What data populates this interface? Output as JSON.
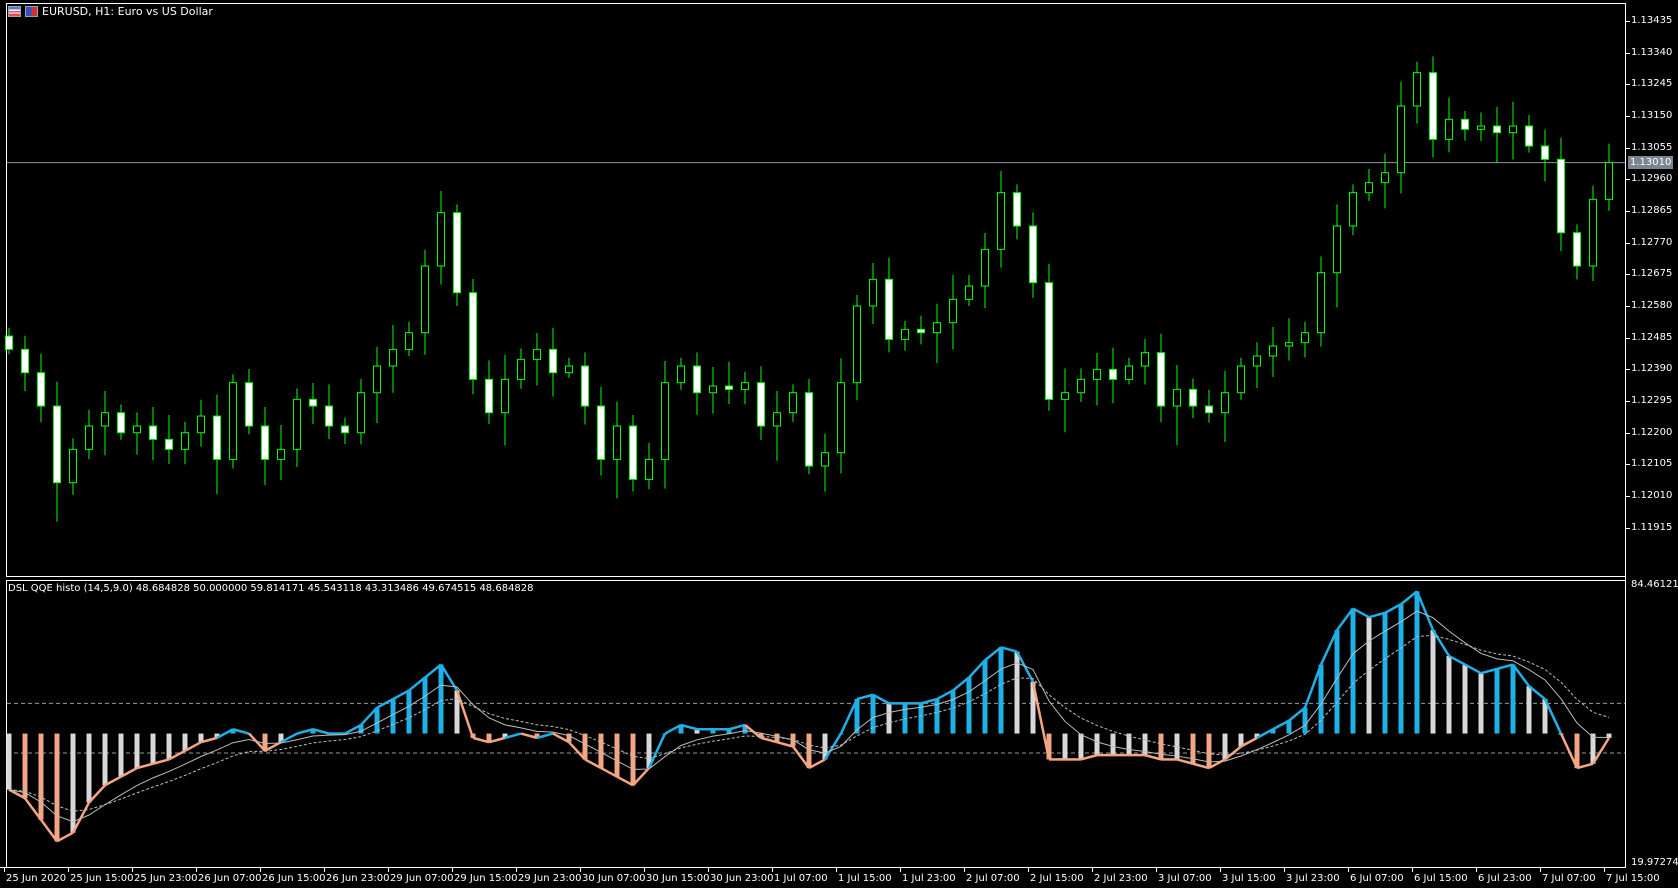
{
  "window": {
    "title": "EURUSD, H1:  Euro vs US Dollar"
  },
  "indicator": {
    "label": "DSL QQE histo (14,5,9.0) 48.684828 50.000000 59.814171 45.543118 43.313486 49.674515 48.684828",
    "max_label": "84.461210",
    "min_label": "19.972748",
    "max": 84.46121,
    "min": 19.972748,
    "mid": 50,
    "upper_level": 57,
    "lower_level": 45.5
  },
  "price_axis": {
    "labels": [
      "1.13435",
      "1.13340",
      "1.13245",
      "1.13150",
      "1.13055",
      "1.12960",
      "1.12865",
      "1.12770",
      "1.12675",
      "1.12580",
      "1.12485",
      "1.12390",
      "1.12295",
      "1.12200",
      "1.12105",
      "1.12010",
      "1.11915"
    ],
    "current_price": "1.13010"
  },
  "time_axis": {
    "labels": [
      "25 Jun 2020",
      "25 Jun 15:00",
      "25 Jun 23:00",
      "26 Jun 07:00",
      "26 Jun 15:00",
      "26 Jun 23:00",
      "29 Jun 07:00",
      "29 Jun 15:00",
      "29 Jun 23:00",
      "30 Jun 07:00",
      "30 Jun 15:00",
      "30 Jun 23:00",
      "1 Jul 07:00",
      "1 Jul 15:00",
      "1 Jul 23:00",
      "2 Jul 07:00",
      "2 Jul 15:00",
      "2 Jul 23:00",
      "3 Jul 07:00",
      "3 Jul 15:00",
      "3 Jul 23:00",
      "6 Jul 07:00",
      "6 Jul 15:00",
      "6 Jul 23:00",
      "7 Jul 07:00",
      "7 Jul 15:00"
    ]
  },
  "colors": {
    "bull": "#00ff00",
    "bear_fill": "#ffffff",
    "up": "#1fb0e6",
    "down": "#f4a582",
    "neutral": "#d8d8d8",
    "grid": "#999999"
  },
  "chart_data": {
    "type": "candlestick",
    "symbol": "EURUSD",
    "timeframe": "H1",
    "ylim": [
      1.1187,
      1.1346
    ],
    "closes": [
      1.1245,
      1.1238,
      1.1228,
      1.1205,
      1.1215,
      1.1222,
      1.1226,
      1.122,
      1.1222,
      1.1218,
      1.1215,
      1.122,
      1.1225,
      1.1212,
      1.1235,
      1.1222,
      1.1212,
      1.1215,
      1.123,
      1.1228,
      1.1222,
      1.122,
      1.1232,
      1.124,
      1.1245,
      1.125,
      1.127,
      1.1286,
      1.1262,
      1.1236,
      1.1226,
      1.1236,
      1.1242,
      1.1245,
      1.1238,
      1.124,
      1.1228,
      1.1212,
      1.1222,
      1.1206,
      1.1212,
      1.1235,
      1.124,
      1.1232,
      1.1234,
      1.1233,
      1.1235,
      1.1222,
      1.1226,
      1.1232,
      1.121,
      1.1214,
      1.1235,
      1.1258,
      1.1266,
      1.1248,
      1.1251,
      1.125,
      1.1253,
      1.126,
      1.1264,
      1.1275,
      1.1292,
      1.1282,
      1.1265,
      1.123,
      1.1232,
      1.1236,
      1.1239,
      1.1236,
      1.124,
      1.1244,
      1.1228,
      1.1233,
      1.1228,
      1.1226,
      1.1232,
      1.124,
      1.1243,
      1.1246,
      1.1247,
      1.125,
      1.1268,
      1.1282,
      1.1292,
      1.1295,
      1.1298,
      1.1318,
      1.1328,
      1.1308,
      1.1314,
      1.1311,
      1.1312,
      1.131,
      1.1312,
      1.1306,
      1.1302,
      1.128,
      1.127,
      1.129,
      1.1301
    ],
    "qqe": [
      37,
      35,
      30,
      25,
      27,
      34,
      38,
      40,
      42,
      43,
      44,
      46,
      48,
      49,
      51,
      50,
      46,
      48,
      50,
      51,
      50,
      50,
      52,
      56,
      58,
      60,
      63,
      66,
      60,
      49,
      48,
      49,
      50,
      49,
      50,
      48,
      44,
      42,
      40,
      38,
      42,
      50,
      52,
      51,
      51,
      51,
      52,
      49,
      48,
      47,
      42,
      44,
      50,
      58,
      59,
      57,
      57,
      57,
      58,
      60,
      63,
      67,
      70,
      69,
      62,
      44,
      44,
      44,
      45,
      45,
      45,
      45,
      44,
      44,
      43,
      42,
      44,
      47,
      49,
      51,
      53,
      56,
      66,
      74,
      79,
      77,
      78,
      80,
      83,
      74,
      68,
      66,
      64,
      65,
      66,
      61,
      58,
      50,
      42,
      43,
      49
    ]
  }
}
